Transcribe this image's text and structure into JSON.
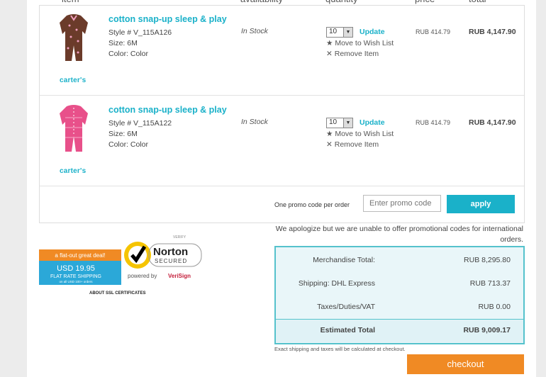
{
  "header": {
    "item": "item",
    "availability": "availability",
    "quantity": "quantity",
    "price": "price",
    "total": "total"
  },
  "items": [
    {
      "brand": "carter's",
      "name": "cotton snap-up sleep & play",
      "style": "Style # V_115A126",
      "size": "Size: 6M",
      "color": "Color: Color",
      "availability": "In Stock",
      "qty": "10",
      "update": "Update",
      "wish": "Move to Wish List",
      "remove": "Remove Item",
      "price": "RUB 414.79",
      "total": "RUB 4,147.90",
      "garment_color": "#6b3b2a"
    },
    {
      "brand": "carter's",
      "name": "cotton snap-up sleep & play",
      "style": "Style # V_115A122",
      "size": "Size: 6M",
      "color": "Color: Color",
      "availability": "In Stock",
      "qty": "10",
      "update": "Update",
      "wish": "Move to Wish List",
      "remove": "Remove Item",
      "price": "RUB 414.79",
      "total": "RUB 4,147.90",
      "garment_color": "#e8508a"
    }
  ],
  "promo": {
    "label": "One promo code per order",
    "placeholder": "Enter promo code",
    "apply": "apply"
  },
  "apology": "We apologize but we are unable to offer promotional codes for international orders.",
  "summary": [
    {
      "label": "Merchandise Total:",
      "value": "RUB 8,295.80"
    },
    {
      "label": "Shipping: DHL Express",
      "value": "RUB 713.37"
    },
    {
      "label": "Taxes/Duties/VAT",
      "value": "RUB 0.00"
    },
    {
      "label": "Estimated Total",
      "value": "RUB 9,009.17"
    }
  ],
  "note": "Exact shipping and taxes will be calculated at checkout.",
  "checkout": "checkout",
  "badges": {
    "deal_line1": "a flat-out great deal!",
    "deal_price": "USD 19.95",
    "deal_line2": "FLAT RATE SHIPPING",
    "deal_line3": "on all USD 100+ orders",
    "norton_verify": "VERIFY",
    "norton_name": "Norton",
    "norton_secured": "SECURED",
    "norton_powered": "powered by",
    "norton_verisign": "VeriSign",
    "ssl": "ABOUT SSL CERTIFICATES"
  },
  "colors": {
    "accent": "#1ab1c9",
    "checkout": "#f08a24",
    "summary_border": "#55c2cc"
  }
}
